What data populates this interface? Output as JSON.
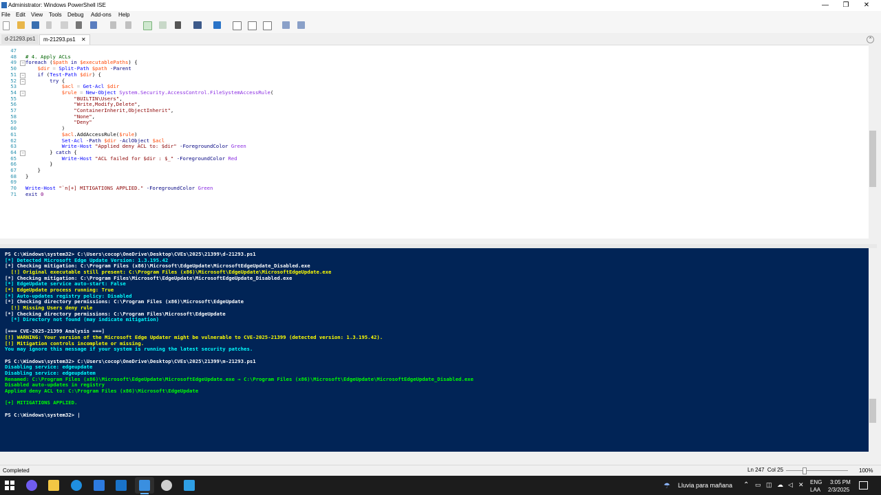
{
  "window": {
    "title": "Administrator: Windows PowerShell ISE",
    "controls": {
      "minimize": "—",
      "restore": "❐",
      "close": "✕"
    }
  },
  "menu": [
    "File",
    "Edit",
    "View",
    "Tools",
    "Debug",
    "Add-ons",
    "Help"
  ],
  "toolbar_icons": [
    "new-script-icon",
    "open-icon",
    "save-icon",
    "cut-icon",
    "copy-icon",
    "paste-icon",
    "clear-icon",
    "undo-icon",
    "redo-icon",
    "run-script-icon",
    "run-selection-icon",
    "stop-icon",
    "remote-powershell-icon",
    "powershell-console-icon",
    "show-script-pane-top-icon",
    "show-script-pane-right-icon",
    "show-script-pane-maximized-icon",
    "show-command-window-icon",
    "show-command-addon-icon"
  ],
  "tabs": [
    {
      "label": "d-21293.ps1",
      "active": false
    },
    {
      "label": "m-21293.ps1",
      "active": true,
      "close": "✕"
    }
  ],
  "editor": {
    "lines": [
      {
        "num": "47",
        "fold": "",
        "segments": [
          {
            "t": "",
            "c": "#000"
          }
        ]
      },
      {
        "num": "48",
        "fold": "",
        "segments": [
          {
            "t": "# 4. Apply ACLs",
            "c": "#006400"
          }
        ]
      },
      {
        "num": "49",
        "fold": "−",
        "segments": [
          {
            "t": "foreach ",
            "c": "#00008b"
          },
          {
            "t": "(",
            "c": "#000"
          },
          {
            "t": "$path",
            "c": "#ff4500"
          },
          {
            "t": " in ",
            "c": "#00008b"
          },
          {
            "t": "$executablePaths",
            "c": "#ff4500"
          },
          {
            "t": ") {",
            "c": "#000"
          }
        ]
      },
      {
        "num": "50",
        "fold": "",
        "segments": [
          {
            "t": "    ",
            "c": "#000"
          },
          {
            "t": "$dir",
            "c": "#ff4500"
          },
          {
            "t": " = ",
            "c": "#a9a9a9"
          },
          {
            "t": "Split-Path",
            "c": "#0000ff"
          },
          {
            "t": " ",
            "c": "#000"
          },
          {
            "t": "$path",
            "c": "#ff4500"
          },
          {
            "t": " -Parent",
            "c": "#000080"
          }
        ]
      },
      {
        "num": "51",
        "fold": "−",
        "segments": [
          {
            "t": "    ",
            "c": "#000"
          },
          {
            "t": "if ",
            "c": "#00008b"
          },
          {
            "t": "(",
            "c": "#000"
          },
          {
            "t": "Test-Path",
            "c": "#0000ff"
          },
          {
            "t": " ",
            "c": "#000"
          },
          {
            "t": "$dir",
            "c": "#ff4500"
          },
          {
            "t": ") {",
            "c": "#000"
          }
        ]
      },
      {
        "num": "52",
        "fold": "−",
        "segments": [
          {
            "t": "        ",
            "c": "#000"
          },
          {
            "t": "try",
            "c": "#00008b"
          },
          {
            "t": " {",
            "c": "#000"
          }
        ]
      },
      {
        "num": "53",
        "fold": "",
        "segments": [
          {
            "t": "            ",
            "c": "#000"
          },
          {
            "t": "$acl",
            "c": "#ff4500"
          },
          {
            "t": " = ",
            "c": "#a9a9a9"
          },
          {
            "t": "Get-Acl",
            "c": "#0000ff"
          },
          {
            "t": " ",
            "c": "#000"
          },
          {
            "t": "$dir",
            "c": "#ff4500"
          }
        ]
      },
      {
        "num": "54",
        "fold": "−",
        "segments": [
          {
            "t": "            ",
            "c": "#000"
          },
          {
            "t": "$rule",
            "c": "#ff4500"
          },
          {
            "t": " = ",
            "c": "#a9a9a9"
          },
          {
            "t": "New-Object",
            "c": "#0000ff"
          },
          {
            "t": " System.Security.AccessControl.FileSystemAccessRule",
            "c": "#8a2be2"
          },
          {
            "t": "(",
            "c": "#000"
          }
        ]
      },
      {
        "num": "55",
        "fold": "",
        "segments": [
          {
            "t": "                ",
            "c": "#000"
          },
          {
            "t": "\"BUILTIN\\Users\"",
            "c": "#8b0000"
          },
          {
            "t": ",",
            "c": "#000"
          }
        ]
      },
      {
        "num": "56",
        "fold": "",
        "segments": [
          {
            "t": "                ",
            "c": "#000"
          },
          {
            "t": "\"Write,Modify,Delete\"",
            "c": "#8b0000"
          },
          {
            "t": ",",
            "c": "#000"
          }
        ]
      },
      {
        "num": "57",
        "fold": "",
        "segments": [
          {
            "t": "                ",
            "c": "#000"
          },
          {
            "t": "\"ContainerInherit,ObjectInherit\"",
            "c": "#8b0000"
          },
          {
            "t": ",",
            "c": "#000"
          }
        ]
      },
      {
        "num": "58",
        "fold": "",
        "segments": [
          {
            "t": "                ",
            "c": "#000"
          },
          {
            "t": "\"None\"",
            "c": "#8b0000"
          },
          {
            "t": ",",
            "c": "#000"
          }
        ]
      },
      {
        "num": "59",
        "fold": "",
        "segments": [
          {
            "t": "                ",
            "c": "#000"
          },
          {
            "t": "\"Deny\"",
            "c": "#8b0000"
          }
        ]
      },
      {
        "num": "60",
        "fold": "",
        "segments": [
          {
            "t": "            )",
            "c": "#000"
          }
        ]
      },
      {
        "num": "61",
        "fold": "",
        "segments": [
          {
            "t": "            ",
            "c": "#000"
          },
          {
            "t": "$acl",
            "c": "#ff4500"
          },
          {
            "t": ".AddAccessRule(",
            "c": "#000"
          },
          {
            "t": "$rule",
            "c": "#ff4500"
          },
          {
            "t": ")",
            "c": "#000"
          }
        ]
      },
      {
        "num": "62",
        "fold": "",
        "segments": [
          {
            "t": "            ",
            "c": "#000"
          },
          {
            "t": "Set-Acl",
            "c": "#0000ff"
          },
          {
            "t": " -Path",
            "c": "#000080"
          },
          {
            "t": " ",
            "c": "#000"
          },
          {
            "t": "$dir",
            "c": "#ff4500"
          },
          {
            "t": " -AclObject",
            "c": "#000080"
          },
          {
            "t": " ",
            "c": "#000"
          },
          {
            "t": "$acl",
            "c": "#ff4500"
          }
        ]
      },
      {
        "num": "63",
        "fold": "",
        "segments": [
          {
            "t": "            ",
            "c": "#000"
          },
          {
            "t": "Write-Host",
            "c": "#0000ff"
          },
          {
            "t": " ",
            "c": "#000"
          },
          {
            "t": "\"Applied deny ACL to: $dir\"",
            "c": "#8b0000"
          },
          {
            "t": " -ForegroundColor",
            "c": "#000080"
          },
          {
            "t": " Green",
            "c": "#8a2be2"
          }
        ]
      },
      {
        "num": "64",
        "fold": "−",
        "segments": [
          {
            "t": "        } ",
            "c": "#000"
          },
          {
            "t": "catch",
            "c": "#00008b"
          },
          {
            "t": " {",
            "c": "#000"
          }
        ]
      },
      {
        "num": "65",
        "fold": "",
        "segments": [
          {
            "t": "            ",
            "c": "#000"
          },
          {
            "t": "Write-Host",
            "c": "#0000ff"
          },
          {
            "t": " ",
            "c": "#000"
          },
          {
            "t": "\"ACL failed for $dir : $_\"",
            "c": "#8b0000"
          },
          {
            "t": " -ForegroundColor",
            "c": "#000080"
          },
          {
            "t": " Red",
            "c": "#8a2be2"
          }
        ]
      },
      {
        "num": "66",
        "fold": "",
        "segments": [
          {
            "t": "        }",
            "c": "#000"
          }
        ]
      },
      {
        "num": "67",
        "fold": "",
        "segments": [
          {
            "t": "    }",
            "c": "#000"
          }
        ]
      },
      {
        "num": "68",
        "fold": "",
        "segments": [
          {
            "t": "}",
            "c": "#000"
          }
        ]
      },
      {
        "num": "69",
        "fold": "",
        "segments": [
          {
            "t": "",
            "c": "#000"
          }
        ]
      },
      {
        "num": "70",
        "fold": "",
        "segments": [
          {
            "t": "Write-Host",
            "c": "#0000ff"
          },
          {
            "t": " ",
            "c": "#000"
          },
          {
            "t": "\"`n[+] MITIGATIONS APPLIED.\"",
            "c": "#8b0000"
          },
          {
            "t": " -ForegroundColor",
            "c": "#000080"
          },
          {
            "t": " Green",
            "c": "#8a2be2"
          }
        ]
      },
      {
        "num": "71",
        "fold": "",
        "segments": [
          {
            "t": "exit",
            "c": "#00008b"
          },
          {
            "t": " 0",
            "c": "#800080"
          }
        ]
      }
    ]
  },
  "console": {
    "lines": [
      {
        "t": "PS C:\\Windows\\system32> C:\\Users\\cocop\\OneDrive\\Desktop\\CVEs\\2025\\21399\\d-21293.ps1",
        "c": "#ffffff"
      },
      {
        "t": "[*] Detected Microsoft Edge Update Version: 1.3.195.42",
        "c": "#00ffff"
      },
      {
        "t": "[*] Checking mitigation: C:\\Program Files (x86)\\Microsoft\\EdgeUpdate\\MicrosoftEdgeUpdate_Disabled.exe",
        "c": "#ffffff"
      },
      {
        "t": "  [!] Original executable still present: C:\\Program Files (x86)\\Microsoft\\EdgeUpdate\\MicrosoftEdgeUpdate.exe",
        "c": "#ffff00"
      },
      {
        "t": "[*] Checking mitigation: C:\\Program Files\\Microsoft\\EdgeUpdate\\MicrosoftEdgeUpdate_Disabled.exe",
        "c": "#ffffff"
      },
      {
        "t": "[*] EdgeUpdate service auto-start: False",
        "c": "#00ffff"
      },
      {
        "t": "[*] EdgeUpdate process running: True",
        "c": "#ffff00"
      },
      {
        "t": "[*] Auto-updates registry policy: Disabled",
        "c": "#00ffff"
      },
      {
        "t": "[*] Checking directory permissions: C:\\Program Files (x86)\\Microsoft\\EdgeUpdate",
        "c": "#ffffff"
      },
      {
        "t": "  [!] Missing Users deny rule",
        "c": "#ffff00"
      },
      {
        "t": "[*] Checking directory permissions: C:\\Program Files\\Microsoft\\EdgeUpdate",
        "c": "#ffffff"
      },
      {
        "t": "  [*] Directory not found (may indicate mitigation)",
        "c": "#00ffff"
      },
      {
        "t": "",
        "c": "#ffffff"
      },
      {
        "t": "[=== CVE-2025-21399 Analysis ===]",
        "c": "#ffffff"
      },
      {
        "t": "[!] WARNING: Your version of the Microsoft Edge Updater might be vulnerable to CVE-2025-21399 (detected version: 1.3.195.42).",
        "c": "#ffff00"
      },
      {
        "t": "[!] Mitigation controls incomplete or missing.",
        "c": "#ffff00"
      },
      {
        "t": "You may ignore this message if your system is running the latest security patches.",
        "c": "#00ffff"
      },
      {
        "t": "",
        "c": "#ffffff"
      },
      {
        "t": "PS C:\\Windows\\system32> C:\\Users\\cocop\\OneDrive\\Desktop\\CVEs\\2025\\21399\\m-21293.ps1",
        "c": "#ffffff"
      },
      {
        "t": "Disabling service: edgeupdate",
        "c": "#00ffff"
      },
      {
        "t": "Disabling service: edgeupdatem",
        "c": "#00ffff"
      },
      {
        "t": "Renamed: C:\\Program Files (x86)\\Microsoft\\EdgeUpdate\\MicrosoftEdgeUpdate.exe → C:\\Program Files (x86)\\Microsoft\\EdgeUpdate\\MicrosoftEdgeUpdate_Disabled.exe",
        "c": "#00ff00"
      },
      {
        "t": "Disabled auto-updates in registry",
        "c": "#00ff00"
      },
      {
        "t": "Applied deny ACL to: C:\\Program Files (x86)\\Microsoft\\EdgeUpdate",
        "c": "#00ff00"
      },
      {
        "t": "",
        "c": "#ffffff"
      },
      {
        "t": "[+] MITIGATIONS APPLIED.",
        "c": "#00ff00"
      },
      {
        "t": "",
        "c": "#ffffff"
      },
      {
        "t": "PS C:\\Windows\\system32> |",
        "c": "#ffffff"
      }
    ]
  },
  "status": {
    "text": "Completed",
    "position": "Ln 247  Col 25",
    "zoom": "100%"
  },
  "taskbar": {
    "apps": [
      "start-icon",
      "copilot-icon",
      "file-explorer-icon",
      "edge-icon",
      "store-icon",
      "mail-icon",
      "powershell-ise-icon",
      "settings-icon",
      "visual-studio-icon"
    ],
    "weather": "Lluvia para mañana",
    "tray_icons": [
      "chevron-up-icon",
      "battery-icon",
      "network-icon",
      "cloud-icon",
      "speaker-icon"
    ],
    "lang_top": "ENG",
    "lang_bottom": "LAA",
    "time": "3:05 PM",
    "date": "2/3/2025"
  }
}
